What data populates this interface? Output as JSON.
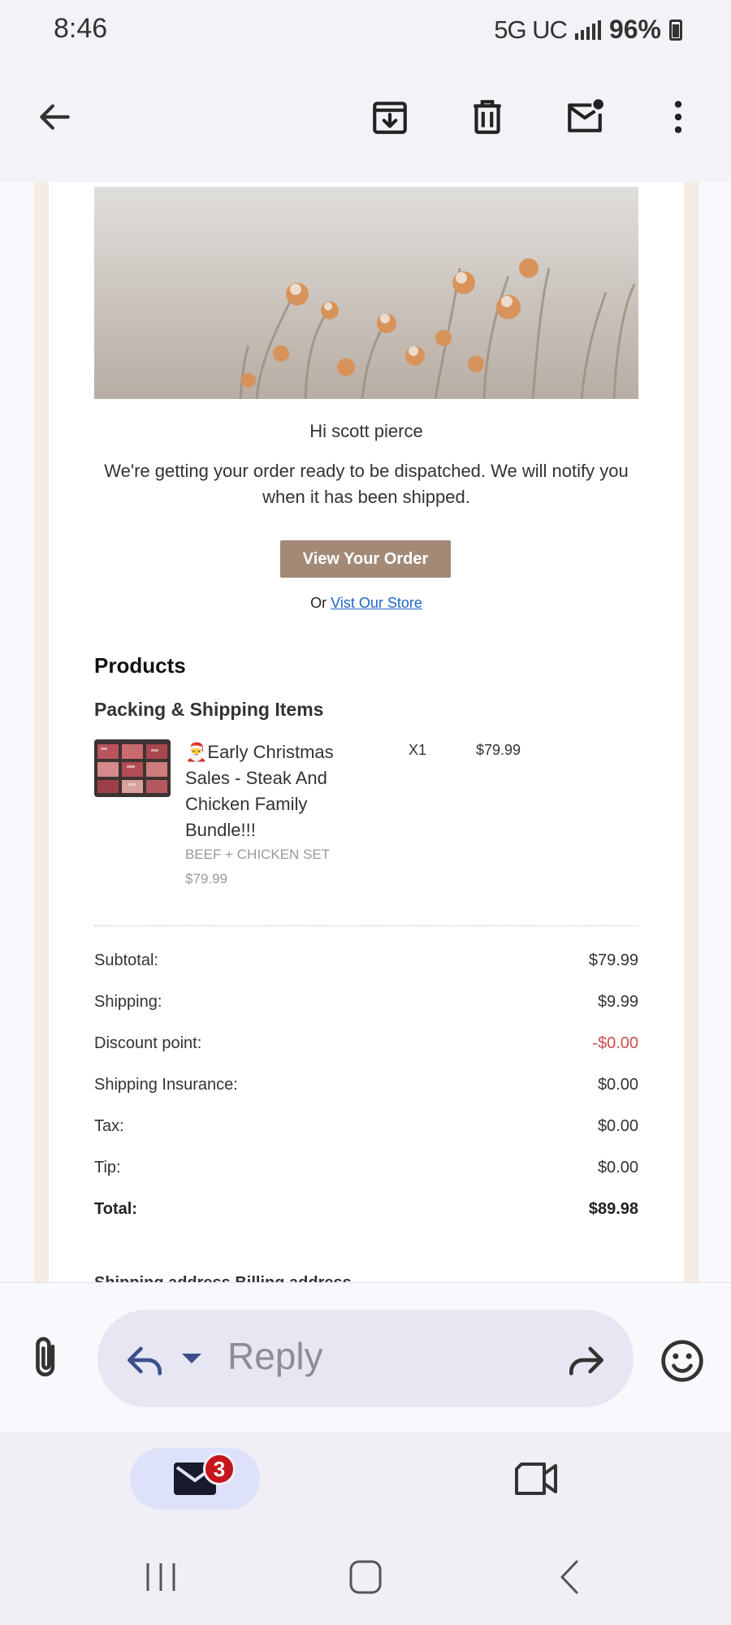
{
  "status_bar": {
    "time": "8:46",
    "network": "5G UC",
    "battery": "96%"
  },
  "toolbar": {
    "icons": [
      "back-arrow-icon",
      "archive-icon",
      "trash-icon",
      "mark-unread-icon",
      "more-vert-icon"
    ]
  },
  "email": {
    "greeting": "Hi scott pierce",
    "message": "We're getting your order ready to be dispatched. We will notify you when it has been shipped.",
    "view_order_label": "View Your Order",
    "store_prefix": "Or",
    "store_link": "Vist Our Store",
    "products_heading": "Products",
    "section_heading": "Packing & Shipping Items",
    "product": {
      "name": "🎅Early Christmas Sales - Steak And Chicken Family Bundle!!!",
      "variant": "BEEF + CHICKEN SET",
      "unit_price": "$79.99",
      "quantity": "X1",
      "line_price": "$79.99"
    },
    "summary": [
      {
        "label": "Subtotal:",
        "value": "$79.99"
      },
      {
        "label": "Shipping:",
        "value": "$9.99"
      },
      {
        "label": "Discount point:",
        "value": "-$0.00"
      },
      {
        "label": "Shipping Insurance:",
        "value": "$0.00"
      },
      {
        "label": "Tax:",
        "value": "$0.00"
      },
      {
        "label": "Tip:",
        "value": "$0.00"
      },
      {
        "label": "Total:",
        "value": "$89.98"
      }
    ],
    "cut_off_text": "Shipping address          Billing address"
  },
  "reply_bar": {
    "placeholder": "Reply"
  },
  "bottom_nav": {
    "mail_badge": "3"
  },
  "colors": {
    "button_brown": "#a28a77",
    "link_blue": "#1f64c8",
    "discount_red": "#d14d4d",
    "badge_red": "#c4161c",
    "frame_beige": "#f5ece3"
  }
}
